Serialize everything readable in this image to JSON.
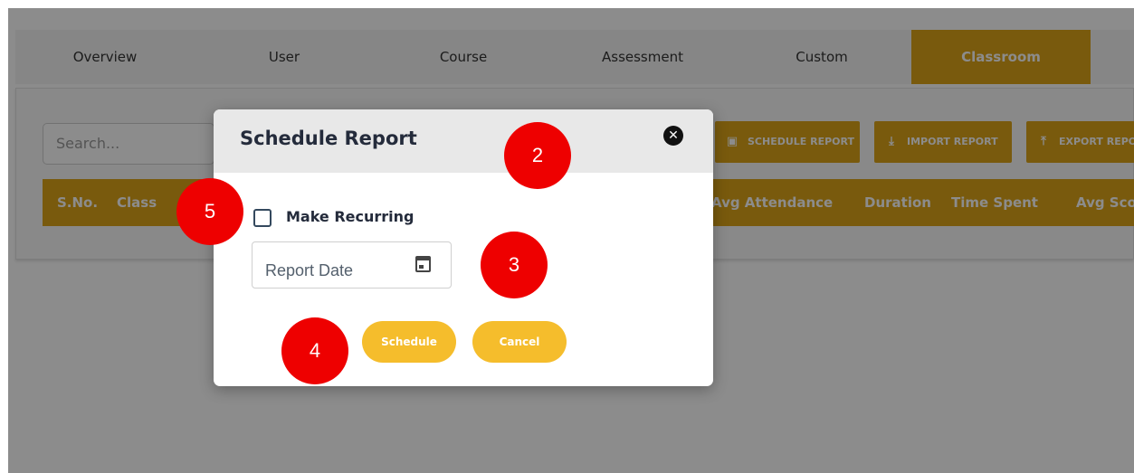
{
  "tabs": [
    {
      "label": "Overview",
      "active": false
    },
    {
      "label": "User",
      "active": false
    },
    {
      "label": "Course",
      "active": false
    },
    {
      "label": "Assessment",
      "active": false
    },
    {
      "label": "Custom",
      "active": false
    },
    {
      "label": "Classroom",
      "active": true
    }
  ],
  "search": {
    "placeholder": "Search..."
  },
  "actions": {
    "schedule_report": "SCHEDULE REPORT",
    "import_report": "IMPORT REPORT",
    "export_report": "EXPORT REPO"
  },
  "table": {
    "headers": [
      "S.No.",
      "Class",
      "Avg Attendance",
      "Duration",
      "Time Spent",
      "Avg Sco"
    ]
  },
  "modal": {
    "title": "Schedule Report",
    "recurring_label": "Make Recurring",
    "recurring_checked": false,
    "date_placeholder": "Report Date",
    "schedule_label": "Schedule",
    "cancel_label": "Cancel"
  },
  "markers": [
    "2",
    "3",
    "4",
    "5"
  ],
  "colors": {
    "accent": "#dca419",
    "button": "#f5bd2c",
    "marker": "#ee0000",
    "title": "#242b3b"
  },
  "icons": {
    "close": "close-circle-icon",
    "calendar": "calendar-icon",
    "import": "download-icon",
    "export": "upload-icon"
  }
}
